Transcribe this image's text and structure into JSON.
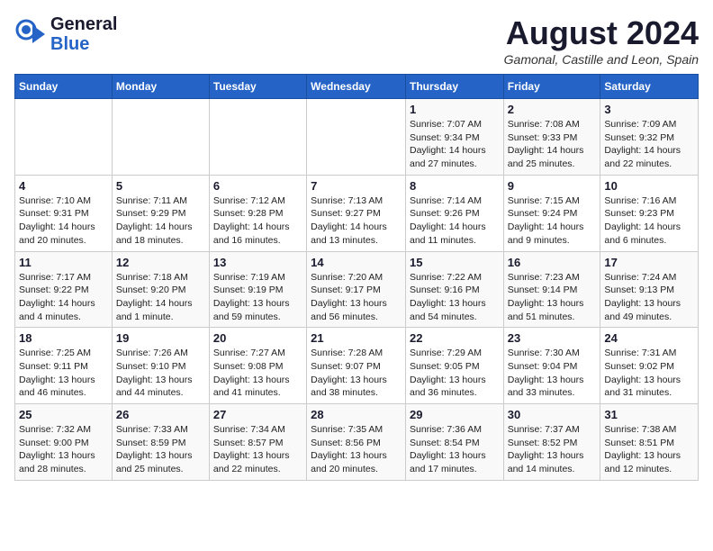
{
  "header": {
    "logo_line1": "General",
    "logo_line2": "Blue",
    "month_year": "August 2024",
    "location": "Gamonal, Castille and Leon, Spain"
  },
  "days_of_week": [
    "Sunday",
    "Monday",
    "Tuesday",
    "Wednesday",
    "Thursday",
    "Friday",
    "Saturday"
  ],
  "weeks": [
    [
      {
        "day": "",
        "info": ""
      },
      {
        "day": "",
        "info": ""
      },
      {
        "day": "",
        "info": ""
      },
      {
        "day": "",
        "info": ""
      },
      {
        "day": "1",
        "info": "Sunrise: 7:07 AM\nSunset: 9:34 PM\nDaylight: 14 hours and 27 minutes."
      },
      {
        "day": "2",
        "info": "Sunrise: 7:08 AM\nSunset: 9:33 PM\nDaylight: 14 hours and 25 minutes."
      },
      {
        "day": "3",
        "info": "Sunrise: 7:09 AM\nSunset: 9:32 PM\nDaylight: 14 hours and 22 minutes."
      }
    ],
    [
      {
        "day": "4",
        "info": "Sunrise: 7:10 AM\nSunset: 9:31 PM\nDaylight: 14 hours and 20 minutes."
      },
      {
        "day": "5",
        "info": "Sunrise: 7:11 AM\nSunset: 9:29 PM\nDaylight: 14 hours and 18 minutes."
      },
      {
        "day": "6",
        "info": "Sunrise: 7:12 AM\nSunset: 9:28 PM\nDaylight: 14 hours and 16 minutes."
      },
      {
        "day": "7",
        "info": "Sunrise: 7:13 AM\nSunset: 9:27 PM\nDaylight: 14 hours and 13 minutes."
      },
      {
        "day": "8",
        "info": "Sunrise: 7:14 AM\nSunset: 9:26 PM\nDaylight: 14 hours and 11 minutes."
      },
      {
        "day": "9",
        "info": "Sunrise: 7:15 AM\nSunset: 9:24 PM\nDaylight: 14 hours and 9 minutes."
      },
      {
        "day": "10",
        "info": "Sunrise: 7:16 AM\nSunset: 9:23 PM\nDaylight: 14 hours and 6 minutes."
      }
    ],
    [
      {
        "day": "11",
        "info": "Sunrise: 7:17 AM\nSunset: 9:22 PM\nDaylight: 14 hours and 4 minutes."
      },
      {
        "day": "12",
        "info": "Sunrise: 7:18 AM\nSunset: 9:20 PM\nDaylight: 14 hours and 1 minute."
      },
      {
        "day": "13",
        "info": "Sunrise: 7:19 AM\nSunset: 9:19 PM\nDaylight: 13 hours and 59 minutes."
      },
      {
        "day": "14",
        "info": "Sunrise: 7:20 AM\nSunset: 9:17 PM\nDaylight: 13 hours and 56 minutes."
      },
      {
        "day": "15",
        "info": "Sunrise: 7:22 AM\nSunset: 9:16 PM\nDaylight: 13 hours and 54 minutes."
      },
      {
        "day": "16",
        "info": "Sunrise: 7:23 AM\nSunset: 9:14 PM\nDaylight: 13 hours and 51 minutes."
      },
      {
        "day": "17",
        "info": "Sunrise: 7:24 AM\nSunset: 9:13 PM\nDaylight: 13 hours and 49 minutes."
      }
    ],
    [
      {
        "day": "18",
        "info": "Sunrise: 7:25 AM\nSunset: 9:11 PM\nDaylight: 13 hours and 46 minutes."
      },
      {
        "day": "19",
        "info": "Sunrise: 7:26 AM\nSunset: 9:10 PM\nDaylight: 13 hours and 44 minutes."
      },
      {
        "day": "20",
        "info": "Sunrise: 7:27 AM\nSunset: 9:08 PM\nDaylight: 13 hours and 41 minutes."
      },
      {
        "day": "21",
        "info": "Sunrise: 7:28 AM\nSunset: 9:07 PM\nDaylight: 13 hours and 38 minutes."
      },
      {
        "day": "22",
        "info": "Sunrise: 7:29 AM\nSunset: 9:05 PM\nDaylight: 13 hours and 36 minutes."
      },
      {
        "day": "23",
        "info": "Sunrise: 7:30 AM\nSunset: 9:04 PM\nDaylight: 13 hours and 33 minutes."
      },
      {
        "day": "24",
        "info": "Sunrise: 7:31 AM\nSunset: 9:02 PM\nDaylight: 13 hours and 31 minutes."
      }
    ],
    [
      {
        "day": "25",
        "info": "Sunrise: 7:32 AM\nSunset: 9:00 PM\nDaylight: 13 hours and 28 minutes."
      },
      {
        "day": "26",
        "info": "Sunrise: 7:33 AM\nSunset: 8:59 PM\nDaylight: 13 hours and 25 minutes."
      },
      {
        "day": "27",
        "info": "Sunrise: 7:34 AM\nSunset: 8:57 PM\nDaylight: 13 hours and 22 minutes."
      },
      {
        "day": "28",
        "info": "Sunrise: 7:35 AM\nSunset: 8:56 PM\nDaylight: 13 hours and 20 minutes."
      },
      {
        "day": "29",
        "info": "Sunrise: 7:36 AM\nSunset: 8:54 PM\nDaylight: 13 hours and 17 minutes."
      },
      {
        "day": "30",
        "info": "Sunrise: 7:37 AM\nSunset: 8:52 PM\nDaylight: 13 hours and 14 minutes."
      },
      {
        "day": "31",
        "info": "Sunrise: 7:38 AM\nSunset: 8:51 PM\nDaylight: 13 hours and 12 minutes."
      }
    ]
  ]
}
